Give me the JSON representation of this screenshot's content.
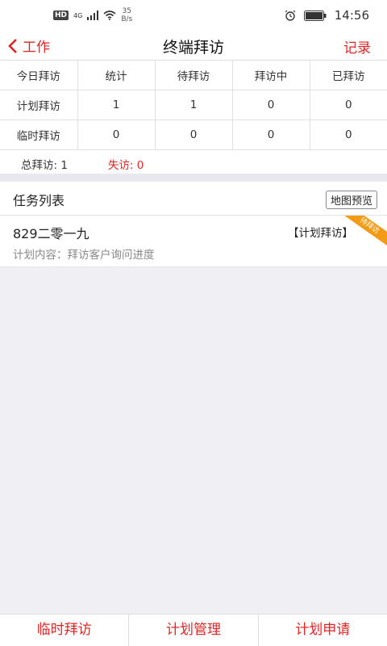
{
  "status": {
    "hd": "HD",
    "network": "4G",
    "speed_value": "35",
    "speed_unit": "B/s",
    "time": "14:56"
  },
  "nav": {
    "back_label": "工作",
    "title": "终端拜访",
    "right_label": "记录"
  },
  "stats": {
    "headers": [
      "今日拜访",
      "统计",
      "待拜访",
      "拜访中",
      "已拜访"
    ],
    "rows": [
      [
        "计划拜访",
        "1",
        "1",
        "0",
        "0"
      ],
      [
        "临时拜访",
        "0",
        "0",
        "0",
        "0"
      ]
    ],
    "total": "总拜访: 1",
    "missed": "失访: 0"
  },
  "tasks": {
    "title": "任务列表",
    "map_button": "地图预览",
    "items": [
      {
        "name": "829二零一九",
        "type": "【计划拜访】",
        "content": "计划内容：拜访客户询问进度",
        "ribbon": "待拜访"
      }
    ]
  },
  "bottom_tabs": [
    "临时拜访",
    "计划管理",
    "计划申请"
  ],
  "colors": {
    "accent": "#e02424",
    "ribbon": "#f39a16"
  }
}
